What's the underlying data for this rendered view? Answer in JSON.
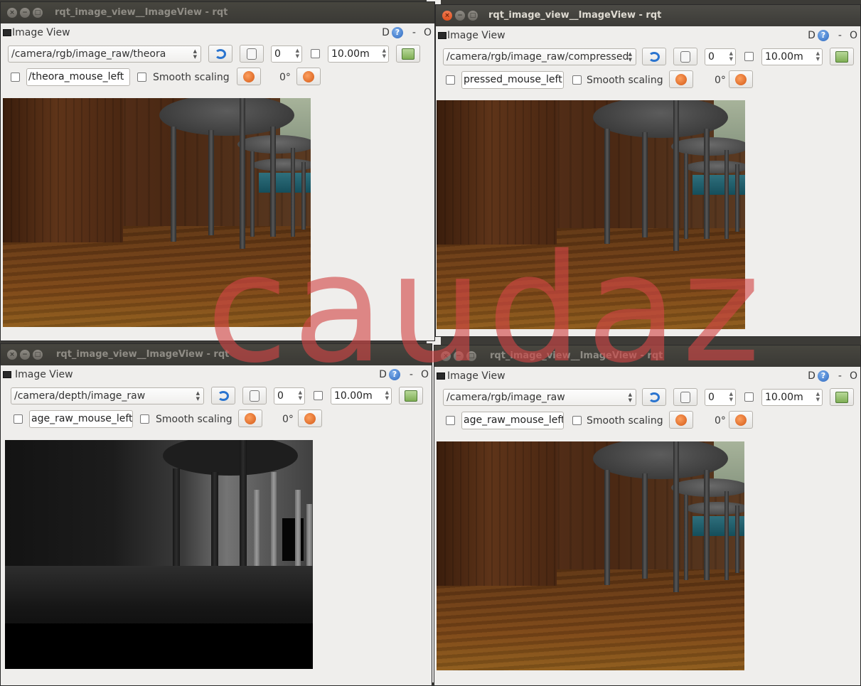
{
  "windows": [
    {
      "title": "rqt_image_view__ImageView - rqt",
      "plugin_title": "Image View",
      "topic": "/camera/rgb/image_raw/theora",
      "num_value": "0",
      "max_range": "10.00m",
      "mouse_topic": "/theora_mouse_left",
      "smooth_label": "Smooth scaling",
      "rotation": "0°",
      "tool_d": "D",
      "tool_q": "?",
      "tool_dash": "-",
      "tool_o": "O",
      "state": "inactive"
    },
    {
      "title": "rqt_image_view__ImageView - rqt",
      "plugin_title": "Image View",
      "topic": "/camera/rgb/image_raw/compressed",
      "num_value": "0",
      "max_range": "10.00m",
      "mouse_topic": "pressed_mouse_left",
      "smooth_label": "Smooth scaling",
      "rotation": "0°",
      "tool_d": "D",
      "tool_q": "?",
      "tool_dash": "-",
      "tool_o": "O",
      "state": "active"
    },
    {
      "title": "rqt_image_view__ImageView - rqt",
      "plugin_title": "Image View",
      "topic": "/camera/depth/image_raw",
      "num_value": "0",
      "max_range": "10.00m",
      "mouse_topic": "age_raw_mouse_left",
      "smooth_label": "Smooth scaling",
      "rotation": "0°",
      "tool_d": "D",
      "tool_q": "?",
      "tool_dash": "-",
      "tool_o": "O",
      "state": "inactive"
    },
    {
      "title": "rqt_image_view__ImageView - rqt",
      "plugin_title": "Image View",
      "topic": "/camera/rgb/image_raw",
      "num_value": "0",
      "max_range": "10.00m",
      "mouse_topic": "age_raw_mouse_left",
      "smooth_label": "Smooth scaling",
      "rotation": "0°",
      "tool_d": "D",
      "tool_q": "?",
      "tool_dash": "-",
      "tool_o": "O",
      "state": "inactive"
    }
  ],
  "watermark": "caudaz",
  "icons": {
    "refresh": "refresh-icon",
    "pan": "pan-icon",
    "save": "save-image-icon",
    "rotate_left": "rotate-left-icon",
    "rotate_right": "rotate-right-icon",
    "help": "help-icon"
  }
}
